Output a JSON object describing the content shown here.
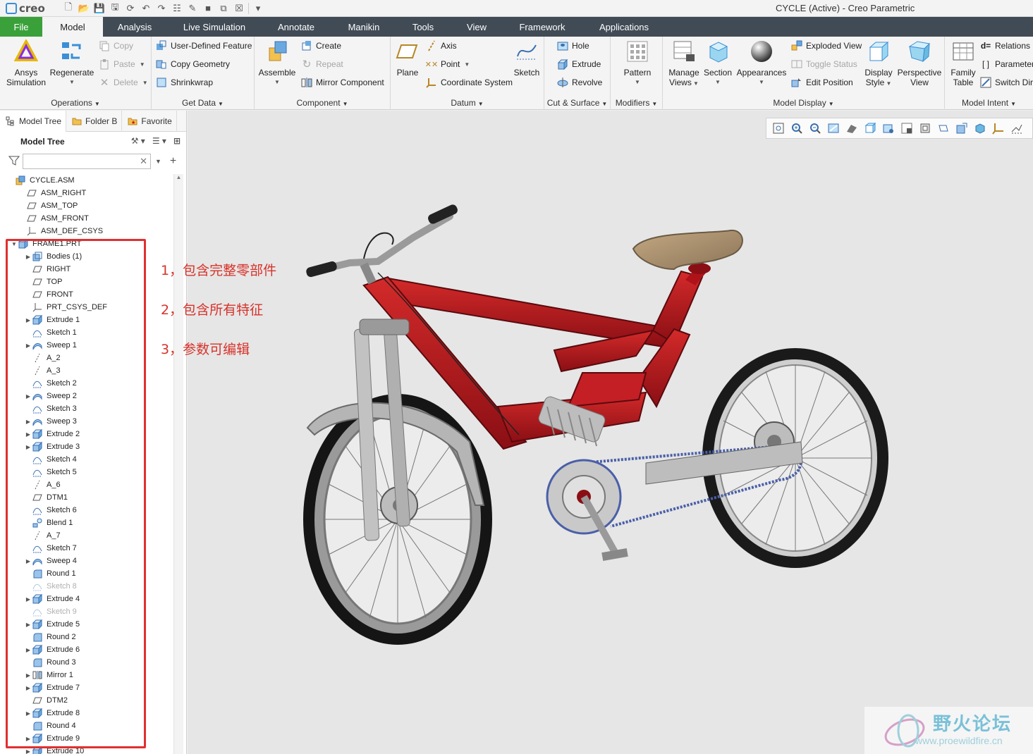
{
  "app": {
    "logo_text": "creo",
    "window_title": "CYCLE (Active) - Creo Parametric"
  },
  "tabs": [
    {
      "label": "File"
    },
    {
      "label": "Model"
    },
    {
      "label": "Analysis"
    },
    {
      "label": "Live Simulation"
    },
    {
      "label": "Annotate"
    },
    {
      "label": "Manikin"
    },
    {
      "label": "Tools"
    },
    {
      "label": "View"
    },
    {
      "label": "Framework"
    },
    {
      "label": "Applications"
    }
  ],
  "ribbon": {
    "operations": {
      "label": "Operations",
      "ansys_line1": "Ansys",
      "ansys_line2": "Simulation",
      "regenerate": "Regenerate",
      "copy": "Copy",
      "paste": "Paste",
      "delete": "Delete"
    },
    "get_data": {
      "label": "Get Data",
      "udf": "User-Defined Feature",
      "copy_geometry": "Copy Geometry",
      "shrinkwrap": "Shrinkwrap"
    },
    "component": {
      "label": "Component",
      "assemble": "Assemble",
      "create": "Create",
      "repeat": "Repeat",
      "mirror": "Mirror Component"
    },
    "datum": {
      "label": "Datum",
      "plane": "Plane",
      "axis": "Axis",
      "point": "Point",
      "csys": "Coordinate System",
      "sketch": "Sketch"
    },
    "cut_surface": {
      "label": "Cut & Surface",
      "hole": "Hole",
      "extrude": "Extrude",
      "revolve": "Revolve"
    },
    "modifiers": {
      "label": "Modifiers",
      "pattern": "Pattern"
    },
    "model_display": {
      "label": "Model Display",
      "manage_line1": "Manage",
      "manage_line2": "Views",
      "section": "Section",
      "appearances": "Appearances",
      "exploded": "Exploded View",
      "toggle": "Toggle Status",
      "edit_position": "Edit Position",
      "display_line1": "Display",
      "display_line2": "Style",
      "persp_line1": "Perspective",
      "persp_line2": "View"
    },
    "model_intent": {
      "label": "Model Intent",
      "family_line1": "Family",
      "family_line2": "Table",
      "relations": "Relations",
      "parameters": "Parameter",
      "switch": "Switch Dir"
    }
  },
  "panel": {
    "tabs": [
      {
        "label": "Model Tree"
      },
      {
        "label": "Folder B"
      },
      {
        "label": "Favorite"
      }
    ],
    "header": "Model Tree",
    "search_value": "",
    "tree": [
      {
        "label": "CYCLE.ASM",
        "icon": "assembly-icon",
        "level": 0
      },
      {
        "label": "ASM_RIGHT",
        "icon": "datum-plane-icon",
        "level": 1
      },
      {
        "label": "ASM_TOP",
        "icon": "datum-plane-icon",
        "level": 1
      },
      {
        "label": "ASM_FRONT",
        "icon": "datum-plane-icon",
        "level": 1
      },
      {
        "label": "ASM_DEF_CSYS",
        "icon": "csys-icon",
        "level": 1
      },
      {
        "label": "FRAME1.PRT",
        "icon": "part-icon",
        "level": 1,
        "expanded": true
      },
      {
        "label": "Bodies (1)",
        "icon": "bodies-icon",
        "level": 2,
        "collapsed": true
      },
      {
        "label": "RIGHT",
        "icon": "datum-plane-icon",
        "level": 2
      },
      {
        "label": "TOP",
        "icon": "datum-plane-icon",
        "level": 2
      },
      {
        "label": "FRONT",
        "icon": "datum-plane-icon",
        "level": 2
      },
      {
        "label": "PRT_CSYS_DEF",
        "icon": "csys-icon",
        "level": 2
      },
      {
        "label": "Extrude 1",
        "icon": "extrude-icon",
        "level": 2,
        "collapsed": true
      },
      {
        "label": "Sketch 1",
        "icon": "sketch-icon",
        "level": 2
      },
      {
        "label": "Sweep 1",
        "icon": "sweep-icon",
        "level": 2,
        "collapsed": true
      },
      {
        "label": "A_2",
        "icon": "axis-icon",
        "level": 2
      },
      {
        "label": "A_3",
        "icon": "axis-icon",
        "level": 2
      },
      {
        "label": "Sketch 2",
        "icon": "sketch-icon",
        "level": 2
      },
      {
        "label": "Sweep 2",
        "icon": "sweep-icon",
        "level": 2,
        "collapsed": true
      },
      {
        "label": "Sketch 3",
        "icon": "sketch-icon",
        "level": 2
      },
      {
        "label": "Sweep 3",
        "icon": "sweep-icon",
        "level": 2,
        "collapsed": true
      },
      {
        "label": "Extrude 2",
        "icon": "extrude-icon",
        "level": 2,
        "collapsed": true
      },
      {
        "label": "Extrude 3",
        "icon": "extrude-icon",
        "level": 2,
        "collapsed": true
      },
      {
        "label": "Sketch 4",
        "icon": "sketch-icon",
        "level": 2
      },
      {
        "label": "Sketch 5",
        "icon": "sketch-icon",
        "level": 2
      },
      {
        "label": "A_6",
        "icon": "axis-icon",
        "level": 2
      },
      {
        "label": "DTM1",
        "icon": "datum-plane-icon",
        "level": 2
      },
      {
        "label": "Sketch 6",
        "icon": "sketch-icon",
        "level": 2
      },
      {
        "label": "Blend 1",
        "icon": "blend-icon",
        "level": 2
      },
      {
        "label": "A_7",
        "icon": "axis-icon",
        "level": 2
      },
      {
        "label": "Sketch 7",
        "icon": "sketch-icon",
        "level": 2
      },
      {
        "label": "Sweep 4",
        "icon": "sweep-icon",
        "level": 2,
        "collapsed": true
      },
      {
        "label": "Round 1",
        "icon": "round-icon",
        "level": 2
      },
      {
        "label": "Sketch 8",
        "icon": "sketch-icon",
        "level": 2,
        "suppressed": true
      },
      {
        "label": "Extrude 4",
        "icon": "extrude-icon",
        "level": 2,
        "collapsed": true
      },
      {
        "label": "Sketch 9",
        "icon": "sketch-icon",
        "level": 2,
        "suppressed": true
      },
      {
        "label": "Extrude 5",
        "icon": "extrude-icon",
        "level": 2,
        "collapsed": true
      },
      {
        "label": "Round 2",
        "icon": "round-icon",
        "level": 2
      },
      {
        "label": "Extrude 6",
        "icon": "extrude-icon",
        "level": 2,
        "collapsed": true
      },
      {
        "label": "Round 3",
        "icon": "round-icon",
        "level": 2
      },
      {
        "label": "Mirror 1",
        "icon": "mirror-icon",
        "level": 2,
        "collapsed": true
      },
      {
        "label": "Extrude 7",
        "icon": "extrude-icon",
        "level": 2,
        "collapsed": true
      },
      {
        "label": "DTM2",
        "icon": "datum-plane-icon",
        "level": 2
      },
      {
        "label": "Extrude 8",
        "icon": "extrude-icon",
        "level": 2,
        "collapsed": true
      },
      {
        "label": "Round 4",
        "icon": "round-icon",
        "level": 2
      },
      {
        "label": "Extrude 9",
        "icon": "extrude-icon",
        "level": 2,
        "collapsed": true
      },
      {
        "label": "Extrude 10",
        "icon": "extrude-icon",
        "level": 2,
        "collapsed": true
      }
    ]
  },
  "annotations": [
    {
      "text": "1，包含完整零部件"
    },
    {
      "text": "2，包含所有特征"
    },
    {
      "text": "3，参数可编辑"
    }
  ],
  "watermark": {
    "title": "野火论坛",
    "url": "www.proewildfire.cn"
  },
  "colors": {
    "tab_bar": "#414b55",
    "file_tab": "#3aa13a",
    "frame_red": "#b0121a",
    "annotation_red": "#d8322a",
    "highlight_box": "#e03030",
    "viewport_bg": "#e6e6e6"
  }
}
